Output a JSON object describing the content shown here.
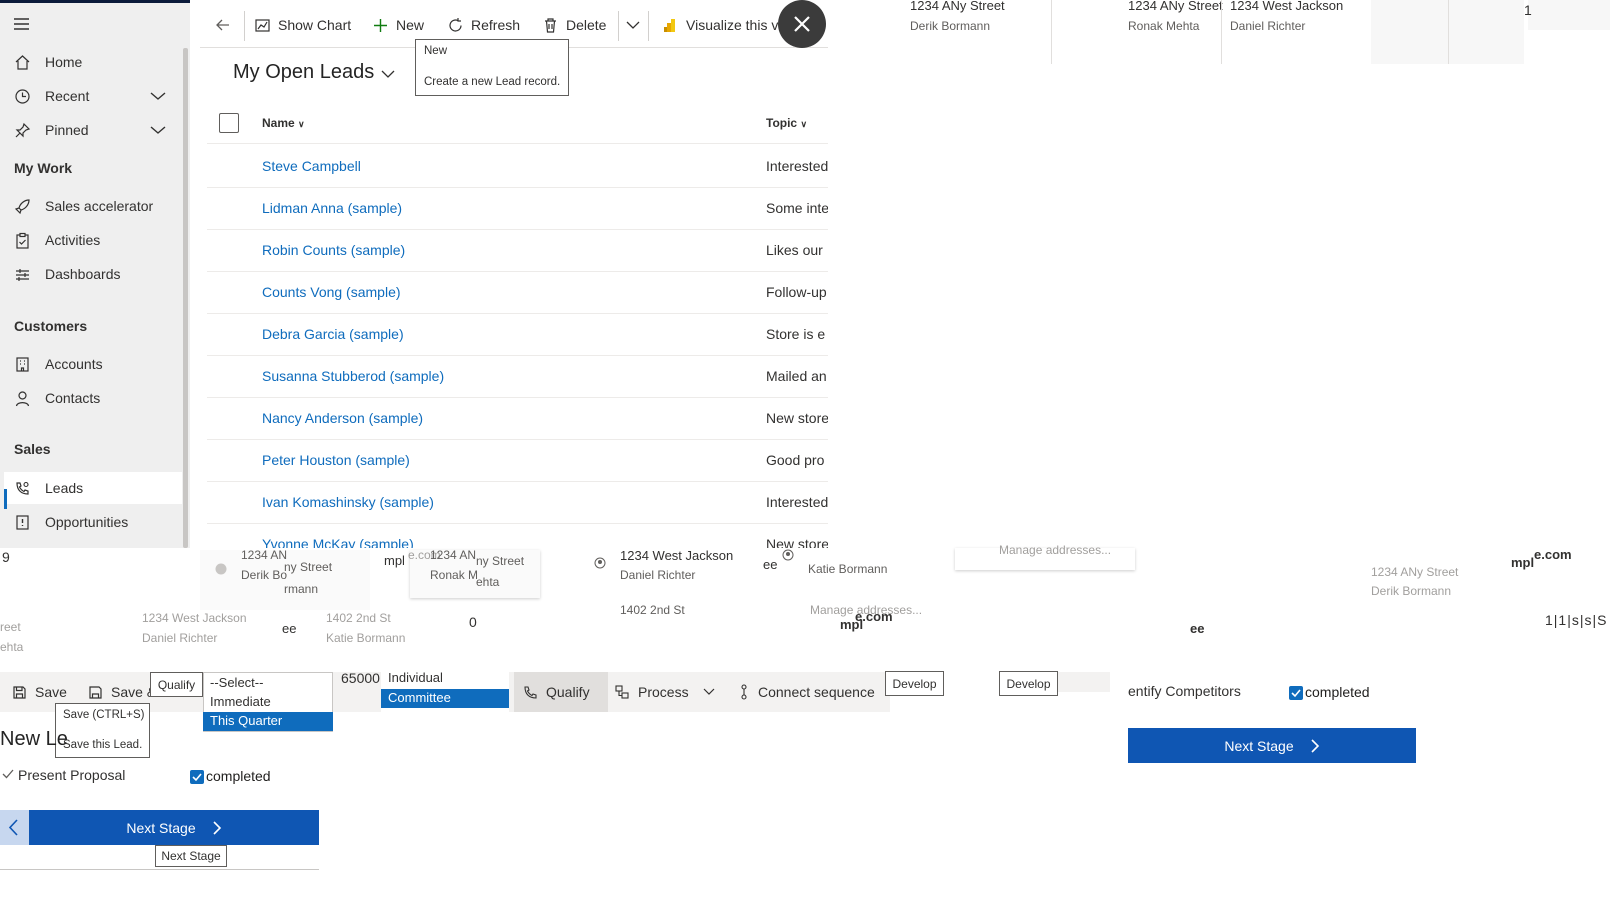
{
  "nav": {
    "items": [
      {
        "label": "Home"
      },
      {
        "label": "Recent"
      },
      {
        "label": "Pinned"
      },
      {
        "label": "Sales accelerator"
      },
      {
        "label": "Activities"
      },
      {
        "label": "Dashboards"
      },
      {
        "label": "Accounts"
      },
      {
        "label": "Contacts"
      },
      {
        "label": "Leads"
      },
      {
        "label": "Opportunities"
      }
    ],
    "groups": [
      "My Work",
      "Customers",
      "Sales"
    ]
  },
  "commandbar": {
    "show_chart": "Show Chart",
    "new": "New",
    "refresh": "Refresh",
    "delete": "Delete",
    "visualize": "Visualize this view"
  },
  "tooltip_new": {
    "title": "New",
    "desc": "Create a new Lead record."
  },
  "view": {
    "title": "My Open Leads"
  },
  "grid": {
    "columns": {
      "name": "Name",
      "topic": "Topic"
    },
    "rows": [
      {
        "name": "Steve Campbell",
        "topic": "Interested"
      },
      {
        "name": "Lidman Anna (sample)",
        "topic": "Some interest"
      },
      {
        "name": "Robin Counts (sample)",
        "topic": "Likes our"
      },
      {
        "name": "Counts Vong (sample)",
        "topic": "Follow-up"
      },
      {
        "name": "Debra Garcia (sample)",
        "topic": "Store is e"
      },
      {
        "name": "Susanna Stubberod (sample)",
        "topic": "Mailed an"
      },
      {
        "name": "Nancy Anderson (sample)",
        "topic": "New store"
      },
      {
        "name": "Peter Houston (sample)",
        "topic": "Good pro"
      },
      {
        "name": "Ivan Komashinsky (sample)",
        "topic": "Interested"
      },
      {
        "name": "Yvonne McKay (sample)",
        "topic": "New store"
      }
    ]
  },
  "top_right": {
    "addr1": "1234 ANy Street",
    "person1": "Derik Bormann",
    "addr2": "1234 ANy Street",
    "person2": "Ronak Mehta",
    "addr3": "1234 West Jackson",
    "person3": "Daniel Richter",
    "cursor_text": "1"
  },
  "fragments": {
    "left_digit": "9",
    "addr_a": "1234 AN",
    "person_a": "Derik Bo",
    "addr_b": "ny Street",
    "person_b": "rmann",
    "mpl1": "mpl",
    "com1": "e.com",
    "addr_c": "1234 AN",
    "person_c": "Ronak M",
    "addr_d": "ny Street",
    "person_d": "ehta",
    "addr_e": "1234 West Jackson",
    "person_e": "Daniel Richter",
    "addr_f": "1402 2nd St",
    "ee1": "ee",
    "person_f": "Katie Bormann",
    "manage1": "Manage addresses...",
    "manage2": "Manage addresses...",
    "com2": "e.com",
    "mpl2": "mpl",
    "addr_g": "1234 ANy Street",
    "person_g": "Derik Bormann",
    "addr_h": "1234 West Jackson",
    "person_h": "Daniel Richter",
    "ee2": "ee",
    "ghost_addr_i": "1402 2nd St",
    "ghost_person_i": "Katie Bormann",
    "zero": "0",
    "mpl3": "mpl",
    "com3": "e.com",
    "ee3": "ee",
    "street_frag": "reet",
    "ehta_frag": "ehta",
    "sigs": "1|1|s|s|S"
  },
  "form": {
    "save": "Save",
    "save_close": "Save &",
    "qualify_box": "Qualify",
    "save_tip_title": "Save (CTRL+S)",
    "save_tip_desc": "Save this Lead.",
    "timeframe_options": [
      "--Select--",
      "Immediate",
      "This Quarter"
    ],
    "timeframe_selected": "This Quarter",
    "budget_value": "65000",
    "purchase_options": [
      "Individual",
      "Committee"
    ],
    "purchase_selected": "Committee",
    "qualify": "Qualify",
    "process": "Process",
    "connect_sequence": "Connect sequence",
    "develop1": "Develop",
    "develop2": "Develop",
    "header_title": "New Le",
    "step_present": "Present Proposal",
    "completed1": "completed",
    "next_stage1": "Next Stage",
    "next_stage_tip": "Next Stage",
    "step_identify": "entify Competitors",
    "completed2": "completed",
    "next_stage2": "Next Stage"
  },
  "colors": {
    "accent": "#0f6cbd",
    "stage_button": "#0f56b3",
    "nav_bg": "#efefef"
  }
}
